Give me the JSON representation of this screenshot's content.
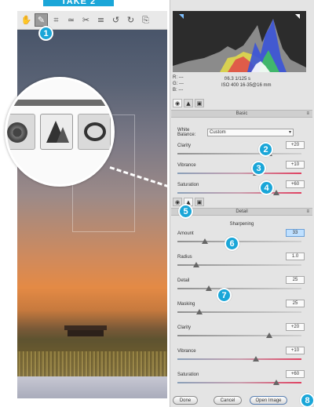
{
  "title_tab": "TAKE 2",
  "toolbar": {
    "tools": [
      "hand-icon",
      "eyedropper-icon",
      "crop-icon",
      "straighten-icon",
      "spot-removal-icon",
      "list-icon",
      "rotate-ccw-icon",
      "rotate-cw-icon",
      "open-prefs-icon"
    ]
  },
  "info": {
    "r": "R:",
    "g": "G:",
    "b": "B:",
    "dash": "---",
    "aperture_shutter": "f/6.3   1/125 s",
    "iso_lens": "ISO 400   16-35@16 mm"
  },
  "panel_tabs": [
    "basic-tab",
    "detail-tab",
    "lens-tab"
  ],
  "basic": {
    "header": "Basic",
    "white_balance_label": "White Balance:",
    "white_balance_value": "Custom",
    "sliders": [
      {
        "label": "Clarity",
        "value": "+20",
        "pos": 0.74
      },
      {
        "label": "Vibrance",
        "value": "+10",
        "pos": 0.63
      },
      {
        "label": "Saturation",
        "value": "+60",
        "pos": 0.8
      }
    ]
  },
  "detail": {
    "header": "Detail",
    "sharpening_label": "Sharpening",
    "sliders": [
      {
        "label": "Amount",
        "value": "33",
        "pos": 0.22,
        "active": true
      },
      {
        "label": "Radius",
        "value": "1.0",
        "pos": 0.15
      },
      {
        "label": "Detail",
        "value": "25",
        "pos": 0.25
      },
      {
        "label": "Masking",
        "value": "25",
        "pos": 0.18
      },
      {
        "label": "Clarity",
        "value": "+20",
        "pos": 0.74
      },
      {
        "label": "Vibrance",
        "value": "+10",
        "pos": 0.63
      },
      {
        "label": "Saturation",
        "value": "+60",
        "pos": 0.8
      }
    ]
  },
  "buttons": {
    "done": "Done",
    "cancel": "Cancel",
    "open": "Open Image"
  },
  "badges": [
    "1",
    "2",
    "3",
    "4",
    "5",
    "6",
    "7",
    "8"
  ],
  "colors": {
    "accent": "#1aa6d8"
  }
}
